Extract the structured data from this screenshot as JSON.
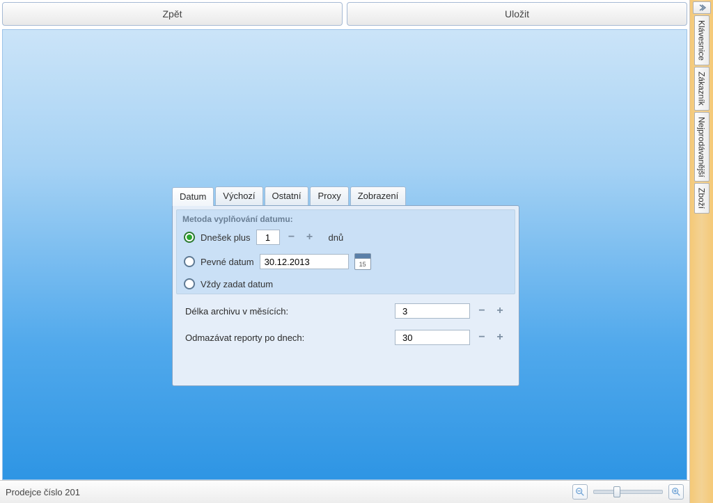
{
  "topButtons": {
    "back": "Zpět",
    "save": "Uložit"
  },
  "tabs": [
    "Datum",
    "Výchozí",
    "Ostatní",
    "Proxy",
    "Zobrazení"
  ],
  "methodGroup": {
    "title": "Metoda vyplňování datumu:",
    "options": {
      "todayPlus": {
        "label_before": "Dnešek plus",
        "value": "1",
        "label_after": "dnů"
      },
      "fixedDate": {
        "label": "Pevné datum",
        "value": "30.12.2013",
        "calendarDay": "15"
      },
      "alwaysEnter": {
        "label": "Vždy zadat datum"
      }
    }
  },
  "settings": {
    "archiveMonths": {
      "label": "Délka archivu v měsících:",
      "value": "3"
    },
    "deleteReportsDays": {
      "label": "Odmazávat reporty po dnech:",
      "value": "30"
    }
  },
  "statusBar": {
    "user": "Prodejce číslo 201"
  },
  "sidePanel": {
    "tabs": [
      "Klávesnice",
      "Zákazník",
      "Nejprodávanější",
      "Zboží"
    ]
  },
  "icons": {
    "minus": "−",
    "plus": "+"
  }
}
